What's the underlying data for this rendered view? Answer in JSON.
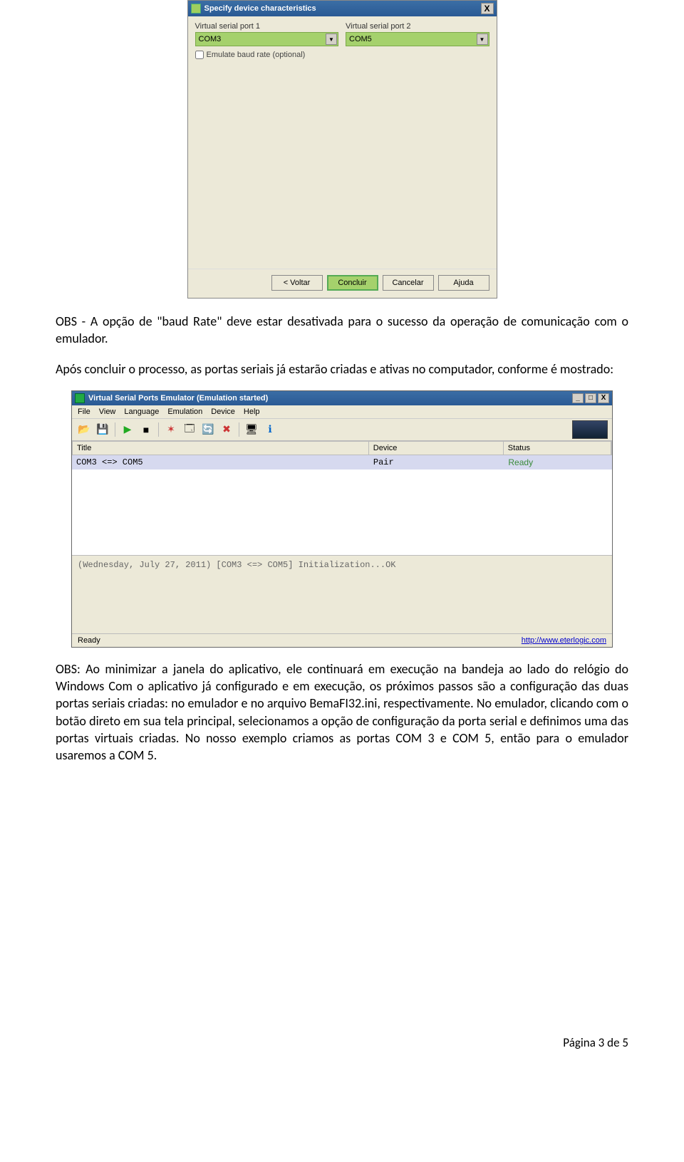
{
  "dialog1": {
    "title": "Specify device characteristics",
    "close_x": "X",
    "port1_label": "Virtual serial port 1",
    "port1_value": "COM3",
    "port2_label": "Virtual serial port 2",
    "port2_value": "COM5",
    "checkbox_label": "Emulate baud rate (optional)",
    "buttons": {
      "back": "< Voltar",
      "finish": "Concluir",
      "cancel": "Cancelar",
      "help": "Ajuda"
    }
  },
  "para1": "OBS - A opção de \"baud Rate\" deve estar desativada para o sucesso da operação de comunicação com o emulador.",
  "para2": "Após concluir o processo, as portas seriais já estarão criadas e ativas no computador, conforme é mostrado:",
  "dialog2": {
    "title": "Virtual Serial Ports Emulator (Emulation started)",
    "win_min": "_",
    "win_max": "□",
    "win_close": "X",
    "menu": [
      "File",
      "View",
      "Language",
      "Emulation",
      "Device",
      "Help"
    ],
    "columns": {
      "title": "Title",
      "device": "Device",
      "status": "Status"
    },
    "row": {
      "title": "COM3 <=> COM5",
      "device": "Pair",
      "status": "Ready"
    },
    "log_line": "(Wednesday, July 27, 2011) [COM3 <=> COM5] Initialization...OK",
    "status_left": "Ready",
    "status_link": "http://www.eterlogic.com"
  },
  "para3": "OBS: Ao minimizar a janela do aplicativo, ele continuará em execução na bandeja ao lado do relógio do Windows Com o aplicativo já configurado e em execução, os próximos passos são a configuração das duas portas seriais criadas: no emulador e no arquivo BemaFI32.ini, respectivamente. No emulador, clicando com o botão direto em sua tela principal, selecionamos a opção de configuração da porta serial e definimos uma das portas virtuais criadas. No nosso exemplo criamos as portas COM 3 e COM 5, então para o emulador usaremos a COM 5.",
  "footer": "Página 3 de 5"
}
